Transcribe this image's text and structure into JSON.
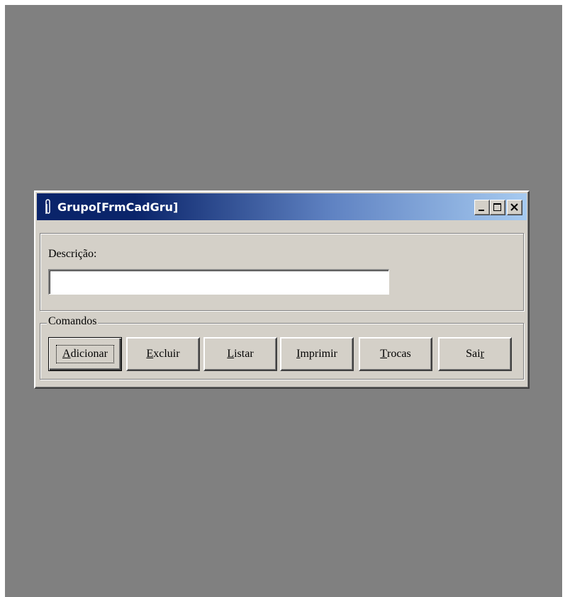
{
  "window": {
    "title": "Grupo[FrmCadGru]",
    "title_icon": "paperclip-icon",
    "caption_buttons": [
      "minimize-icon",
      "maximize-icon",
      "close-icon"
    ]
  },
  "form": {
    "description_label": "Descrição:",
    "description_value": "",
    "commands_group_label": "Comandos"
  },
  "commands": [
    {
      "accel": "A",
      "rest": "dicionar",
      "default": true
    },
    {
      "accel": "E",
      "rest": "xcluir",
      "default": false
    },
    {
      "accel": "L",
      "rest": "istar",
      "default": false
    },
    {
      "accel": "I",
      "rest": "mprimir",
      "default": false
    },
    {
      "accel": "T",
      "rest": "rocas",
      "default": false
    },
    {
      "pre": "Sai",
      "accel": "r",
      "rest": "",
      "default": false
    }
  ],
  "colors": {
    "desktop": "#808080",
    "face": "#d4d0c8",
    "title_start": "#0a246a",
    "title_end": "#a6caf0"
  }
}
